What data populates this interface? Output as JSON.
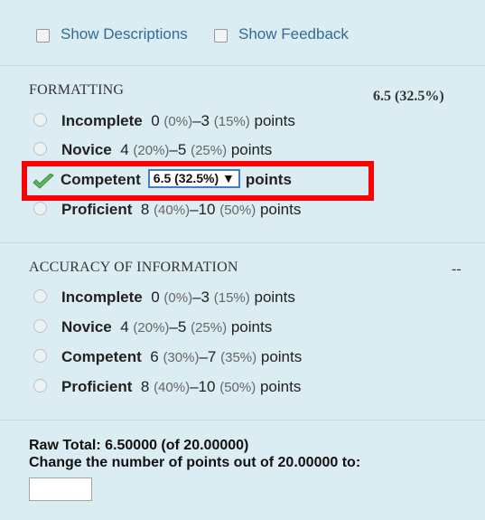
{
  "toolbar": {
    "show_descriptions": "Show Descriptions",
    "show_feedback": "Show Feedback"
  },
  "criteria": [
    {
      "title": "FORMATTING",
      "score": "6.5 (32.5%)",
      "levels": [
        {
          "name": "Incomplete",
          "low": "0",
          "low_pct": "(0%)",
          "high": "3",
          "high_pct": "(15%)",
          "unit": "points"
        },
        {
          "name": "Novice",
          "low": "4",
          "low_pct": "(20%)",
          "high": "5",
          "high_pct": "(25%)",
          "unit": "points"
        },
        {
          "name": "Competent",
          "selected_value": "6.5 (32.5%)",
          "dropdown_arrow": "▼",
          "unit": "points"
        },
        {
          "name": "Proficient",
          "low": "8",
          "low_pct": "(40%)",
          "high": "10",
          "high_pct": "(50%)",
          "unit": "points"
        }
      ]
    },
    {
      "title": "ACCURACY OF INFORMATION",
      "score": "--",
      "levels": [
        {
          "name": "Incomplete",
          "low": "0",
          "low_pct": "(0%)",
          "high": "3",
          "high_pct": "(15%)",
          "unit": "points"
        },
        {
          "name": "Novice",
          "low": "4",
          "low_pct": "(20%)",
          "high": "5",
          "high_pct": "(25%)",
          "unit": "points"
        },
        {
          "name": "Competent",
          "low": "6",
          "low_pct": "(30%)",
          "high": "7",
          "high_pct": "(35%)",
          "unit": "points"
        },
        {
          "name": "Proficient",
          "low": "8",
          "low_pct": "(40%)",
          "high": "10",
          "high_pct": "(50%)",
          "unit": "points"
        }
      ]
    }
  ],
  "footer": {
    "raw_total": "Raw Total: 6.50000 (of 20.00000)",
    "change_points": "Change the number of points out of 20.00000 to:",
    "points_input_value": ""
  },
  "colors": {
    "panel_bg": "#dcecf3",
    "link": "#2f6c98",
    "highlight": "#ff0000",
    "check": "#5cb85c"
  },
  "icons": {
    "selected_level": "check-icon"
  }
}
